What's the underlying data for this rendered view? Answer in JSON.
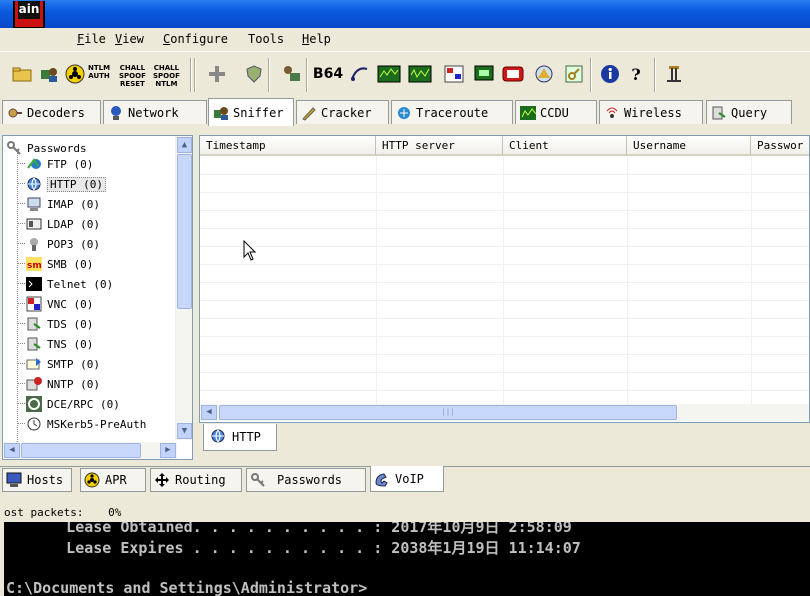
{
  "app": {
    "icon_text": "ain"
  },
  "menu": [
    {
      "label": "File",
      "ul": "F",
      "rest": "ile"
    },
    {
      "label": "View",
      "ul": "V",
      "rest": "iew"
    },
    {
      "label": "Configure",
      "ul": "C",
      "rest": "onfigure"
    },
    {
      "label": "Tools",
      "ul": "",
      "rest": "Tools"
    },
    {
      "label": "Help",
      "ul": "H",
      "rest": "elp"
    }
  ],
  "toolbar": {
    "ntlm_auth": "NTLM\nAUTH",
    "chall_spoof_reset": "CHALL\nSPOOF\nRESET",
    "chall_spoof_ntlm": "CHALL\nSPOOF\nNTLM",
    "b64": "B64"
  },
  "main_tabs": [
    {
      "label": "Decoders",
      "icon": "decoder-icon"
    },
    {
      "label": "Network",
      "icon": "network-icon"
    },
    {
      "label": "Sniffer",
      "icon": "sniffer-icon",
      "active": true
    },
    {
      "label": "Cracker",
      "icon": "cracker-icon"
    },
    {
      "label": "Traceroute",
      "icon": "traceroute-icon"
    },
    {
      "label": "CCDU",
      "icon": "ccdu-icon"
    },
    {
      "label": "Wireless",
      "icon": "wireless-icon"
    },
    {
      "label": "Query",
      "icon": "query-icon"
    }
  ],
  "tree": {
    "root": "Passwords",
    "items": [
      {
        "label": "FTP  (0)"
      },
      {
        "label": "HTTP  (0)",
        "selected": true
      },
      {
        "label": "IMAP  (0)"
      },
      {
        "label": "LDAP  (0)"
      },
      {
        "label": "POP3  (0)"
      },
      {
        "label": "SMB  (0)"
      },
      {
        "label": "Telnet  (0)"
      },
      {
        "label": "VNC  (0)"
      },
      {
        "label": "TDS  (0)"
      },
      {
        "label": "TNS  (0)"
      },
      {
        "label": "SMTP  (0)"
      },
      {
        "label": "NNTP  (0)"
      },
      {
        "label": "DCE/RPC  (0)"
      },
      {
        "label": "MSKerb5-PreAuth"
      }
    ]
  },
  "table": {
    "columns": [
      "Timestamp",
      "HTTP server",
      "Client",
      "Username",
      "Passwor"
    ],
    "rows": []
  },
  "subtab": {
    "label": "HTTP"
  },
  "bottom_tabs": [
    {
      "label": "Hosts"
    },
    {
      "label": "APR"
    },
    {
      "label": "Routing"
    },
    {
      "label": "Passwords"
    },
    {
      "label": "VoIP",
      "active": true
    }
  ],
  "status": {
    "lost_packets_label": "ost packets:",
    "lost_packets_value": "0%"
  },
  "console": {
    "lines": [
      "      Lease Obtained. . . . . . . . . . : 2017年10月9日 2:58:09",
      "      Lease Expires . . . . . . . . . . : 2038年1月19日 11:14:07",
      "",
      "C:\\Documents and Settings\\Administrator>"
    ]
  }
}
